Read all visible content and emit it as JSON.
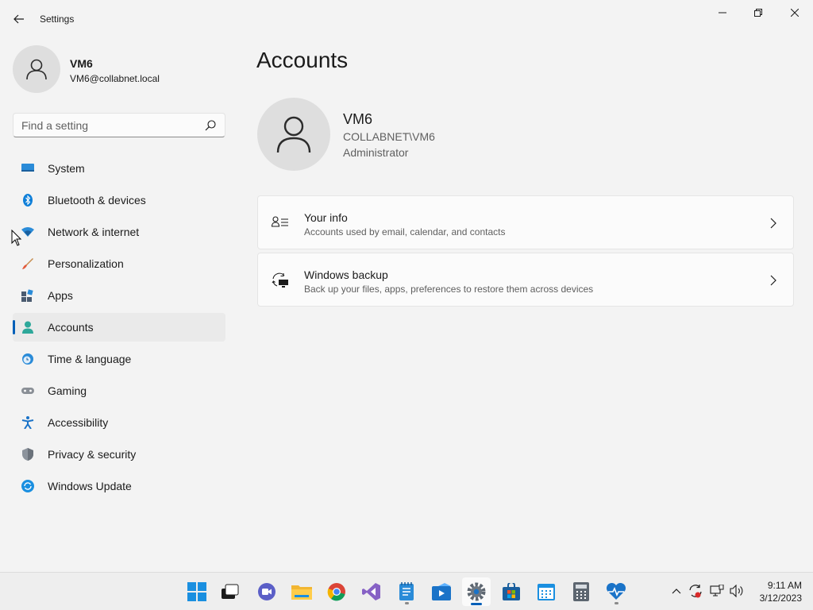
{
  "window": {
    "title": "Settings"
  },
  "profile": {
    "name": "VM6",
    "email": "VM6@collabnet.local"
  },
  "search": {
    "placeholder": "Find a setting"
  },
  "nav": {
    "items": [
      {
        "label": "System",
        "icon": "system-icon"
      },
      {
        "label": "Bluetooth & devices",
        "icon": "bluetooth-icon"
      },
      {
        "label": "Network & internet",
        "icon": "wifi-icon"
      },
      {
        "label": "Personalization",
        "icon": "brush-icon"
      },
      {
        "label": "Apps",
        "icon": "apps-icon"
      },
      {
        "label": "Accounts",
        "icon": "accounts-icon",
        "selected": true
      },
      {
        "label": "Time & language",
        "icon": "clock-globe-icon"
      },
      {
        "label": "Gaming",
        "icon": "gamepad-icon"
      },
      {
        "label": "Accessibility",
        "icon": "accessibility-icon"
      },
      {
        "label": "Privacy & security",
        "icon": "shield-icon"
      },
      {
        "label": "Windows Update",
        "icon": "update-icon"
      }
    ]
  },
  "main": {
    "title": "Accounts",
    "account": {
      "name": "VM6",
      "domain": "COLLABNET\\VM6",
      "role": "Administrator"
    },
    "cards": [
      {
        "title": "Your info",
        "subtitle": "Accounts used by email, calendar, and contacts",
        "icon": "person-info-icon"
      },
      {
        "title": "Windows backup",
        "subtitle": "Back up your files, apps, preferences to restore them across devices",
        "icon": "backup-icon"
      }
    ]
  },
  "taskbar": {
    "apps": [
      "start",
      "task-view",
      "teams",
      "file-explorer",
      "chrome",
      "visual-studio",
      "notepad",
      "media-player",
      "settings",
      "store",
      "calendar",
      "calculator",
      "health-monitor"
    ],
    "active_app": "settings",
    "tray": [
      "chevron-up",
      "sync",
      "network",
      "volume"
    ]
  },
  "clock": {
    "time": "9:11 AM",
    "date": "3/12/2023"
  },
  "colors": {
    "accent": "#005fb8",
    "background": "#f3f3f3",
    "card": "#fbfbfb"
  }
}
